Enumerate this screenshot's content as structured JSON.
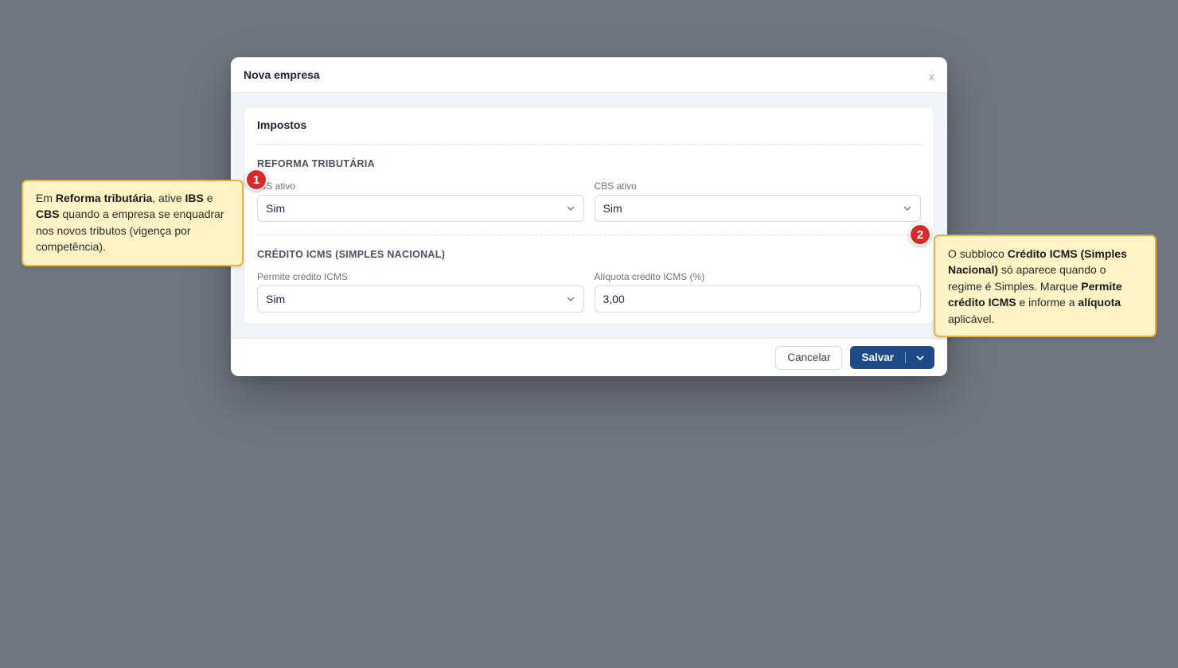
{
  "modal": {
    "title": "Nova empresa",
    "close_label": "x"
  },
  "card": {
    "title": "Impostos"
  },
  "reforma": {
    "section_title": "REFORMA TRIBUTÁRIA",
    "ibs_label": "IBS ativo",
    "ibs_value": "Sim",
    "cbs_label": "CBS ativo",
    "cbs_value": "Sim"
  },
  "credito": {
    "section_title": "CRÉDITO ICMS (SIMPLES NACIONAL)",
    "permite_label": "Permite crédito ICMS",
    "permite_value": "Sim",
    "aliquota_label": "Alíquota crédito ICMS (%)",
    "aliquota_value": "3,00"
  },
  "footer": {
    "cancel_label": "Cancelar",
    "save_label": "Salvar"
  },
  "callouts": [
    {
      "number": "1",
      "parts": [
        {
          "t": "Em "
        },
        {
          "t": "Reforma tributária",
          "b": true
        },
        {
          "t": ", ative "
        },
        {
          "t": "IBS",
          "b": true
        },
        {
          "t": " e "
        },
        {
          "t": "CBS",
          "b": true
        },
        {
          "t": " quando a empresa se enquadrar nos novos tributos (vigença por competência)."
        }
      ]
    },
    {
      "number": "2",
      "parts": [
        {
          "t": "O subbloco "
        },
        {
          "t": "Crédito ICMS (Simples Nacional)",
          "b": true
        },
        {
          "t": " só aparece quando o regime é Simples. Marque "
        },
        {
          "t": "Permite crédito ICMS",
          "b": true
        },
        {
          "t": " e informe a "
        },
        {
          "t": "alíquota",
          "b": true
        },
        {
          "t": " aplicável."
        }
      ]
    }
  ],
  "colors": {
    "backdrop": "#6f7782",
    "primary": "#1e4b87",
    "callout_bg": "#fef3c5",
    "callout_border": "#e9b23a",
    "badge": "#d72a2a"
  }
}
